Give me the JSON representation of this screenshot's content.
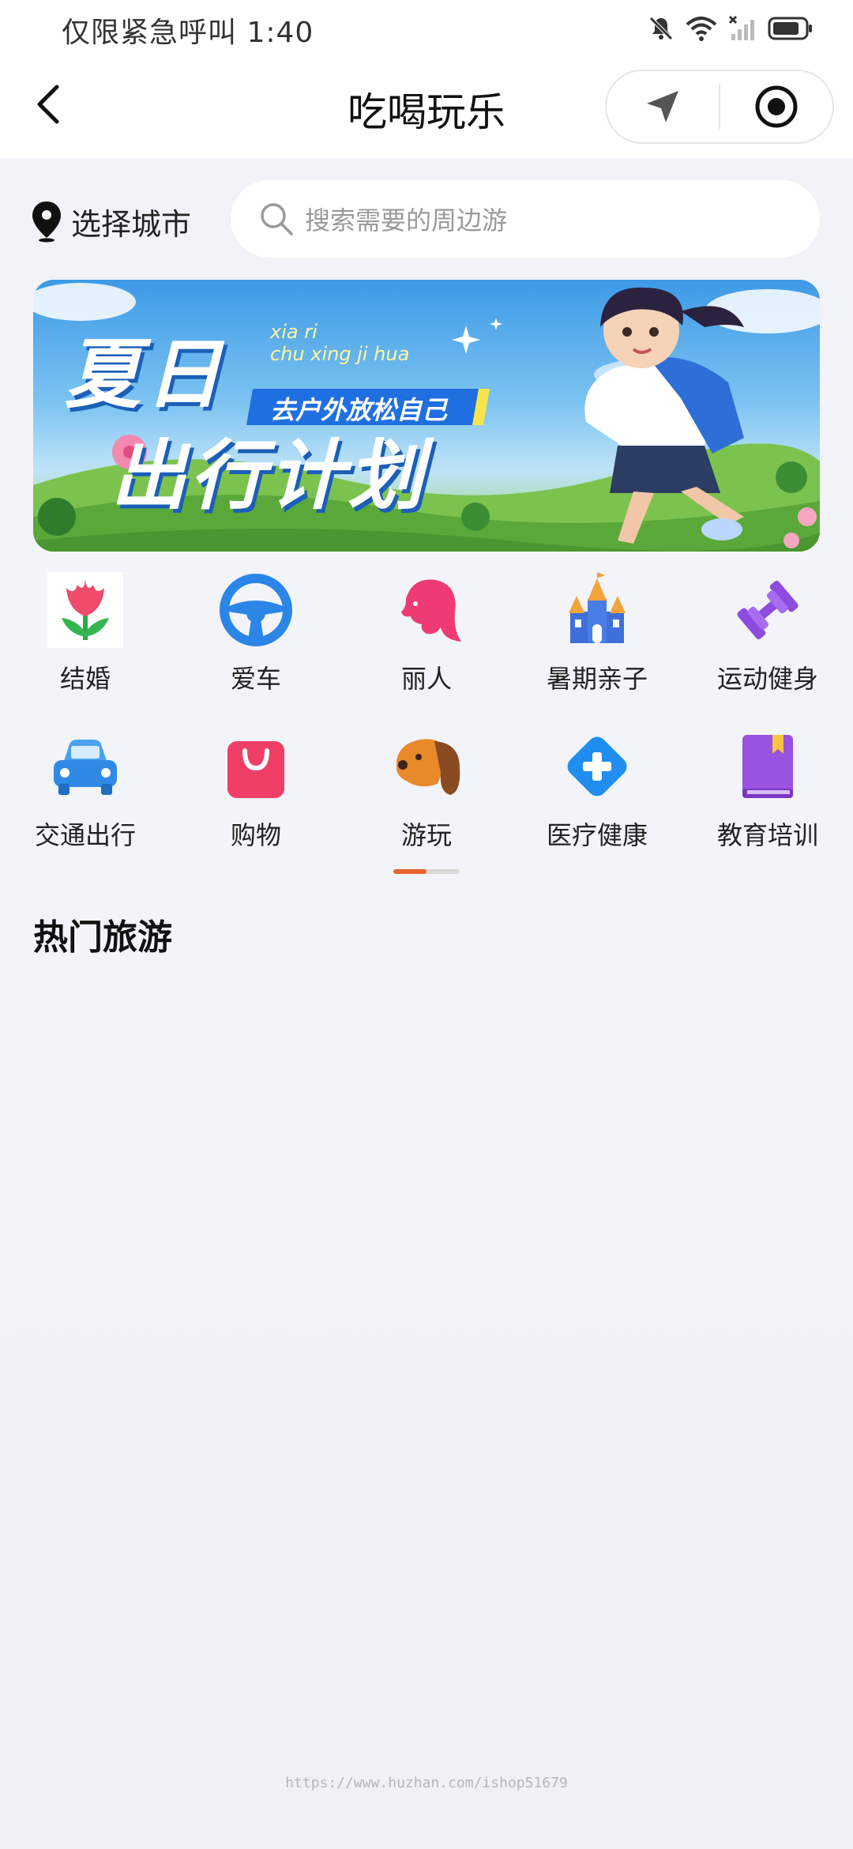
{
  "status_bar": {
    "text": "仅限紧急呼叫 1:40",
    "icons": [
      "mute-bell-icon",
      "wifi-icon",
      "no-signal-icon",
      "battery-icon"
    ]
  },
  "nav": {
    "title": "吃喝玩乐",
    "icons": [
      "back-icon",
      "location-arrow-icon",
      "target-icon"
    ]
  },
  "search": {
    "city_label": "选择城市",
    "placeholder": "搜索需要的周边游"
  },
  "banner": {
    "title_line1": "夏日",
    "title_line2": "出行计划",
    "pinyin_line1": "xia ri",
    "pinyin_line2": "chu xing ji hua",
    "tagline": "去户外放松自己"
  },
  "categories": [
    {
      "label": "结婚",
      "icon": "tulip-icon",
      "color": "#ef4b6a"
    },
    {
      "label": "爱车",
      "icon": "steering-wheel-icon",
      "color": "#2b86e8"
    },
    {
      "label": "丽人",
      "icon": "woman-profile-icon",
      "color": "#ee3b74"
    },
    {
      "label": "暑期亲子",
      "icon": "castle-icon",
      "color": "#3f6fd8"
    },
    {
      "label": "运动健身",
      "icon": "dumbbell-icon",
      "color": "#8d4be0"
    },
    {
      "label": "交通出行",
      "icon": "car-icon",
      "color": "#2f8ae6"
    },
    {
      "label": "购物",
      "icon": "shopping-bag-icon",
      "color": "#ef3f66"
    },
    {
      "label": "游玩",
      "icon": "dog-icon",
      "color": "#e8892a"
    },
    {
      "label": "医疗健康",
      "icon": "medical-cross-icon",
      "color": "#1f8ef0"
    },
    {
      "label": "教育培训",
      "icon": "book-icon",
      "color": "#9a52e0"
    }
  ],
  "pager": {
    "pages": 2,
    "active": 1,
    "active_color": "#e8642c"
  },
  "section": {
    "title": "热门旅游"
  },
  "watermark": "https://www.huzhan.com/ishop51679"
}
